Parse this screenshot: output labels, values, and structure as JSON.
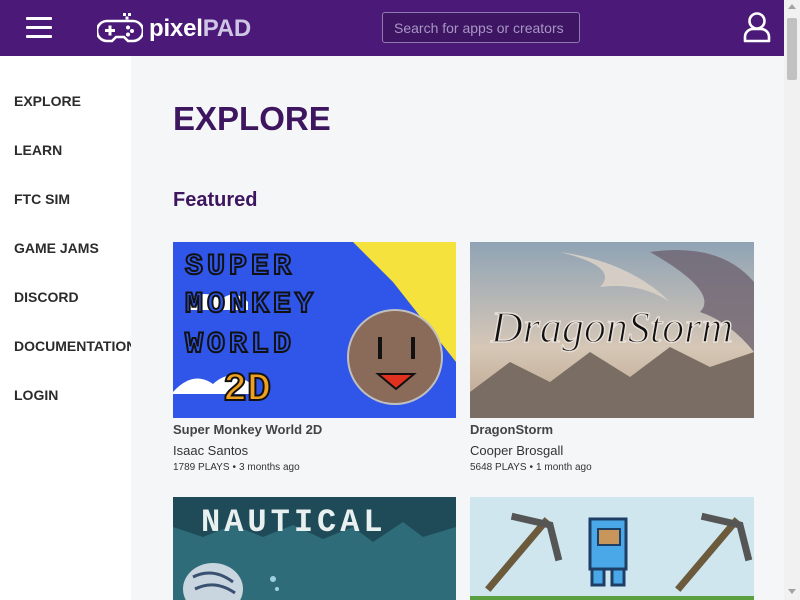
{
  "header": {
    "logo_text_a": "pixel",
    "logo_text_b": "PAD",
    "search_placeholder": "Search for apps or creators",
    "icons": {
      "menu": "hamburger-icon",
      "logo": "gamepad-icon",
      "account": "user-icon"
    },
    "colors": {
      "bar": "#4b1a78",
      "logo_accent": "#cfc6e6"
    }
  },
  "sidebar": {
    "items": [
      {
        "label": "EXPLORE"
      },
      {
        "label": "LEARN"
      },
      {
        "label": "FTC SIM"
      },
      {
        "label": "GAME JAMS"
      },
      {
        "label": "DISCORD"
      },
      {
        "label": "DOCUMENTATION"
      },
      {
        "label": "LOGIN"
      }
    ]
  },
  "main": {
    "title": "EXPLORE",
    "section": "Featured",
    "title_color": "#3e155f",
    "cards": [
      {
        "title": "Super Monkey World 2D",
        "author": "Isaac Santos",
        "plays": "1789 PLAYS",
        "age": "3 months ago",
        "thumb_text": [
          "SUPER",
          "MONKEY",
          "WORLD",
          "2D"
        ]
      },
      {
        "title": "DragonStorm",
        "author": "Cooper Brosgall",
        "plays": "5648 PLAYS",
        "age": "1 month ago",
        "thumb_text": "DragonStorm"
      },
      {
        "title": "",
        "author": "",
        "plays": "",
        "age": "",
        "thumb_text": "NAUTICAL"
      },
      {
        "title": "",
        "author": "",
        "plays": "",
        "age": ""
      }
    ]
  }
}
